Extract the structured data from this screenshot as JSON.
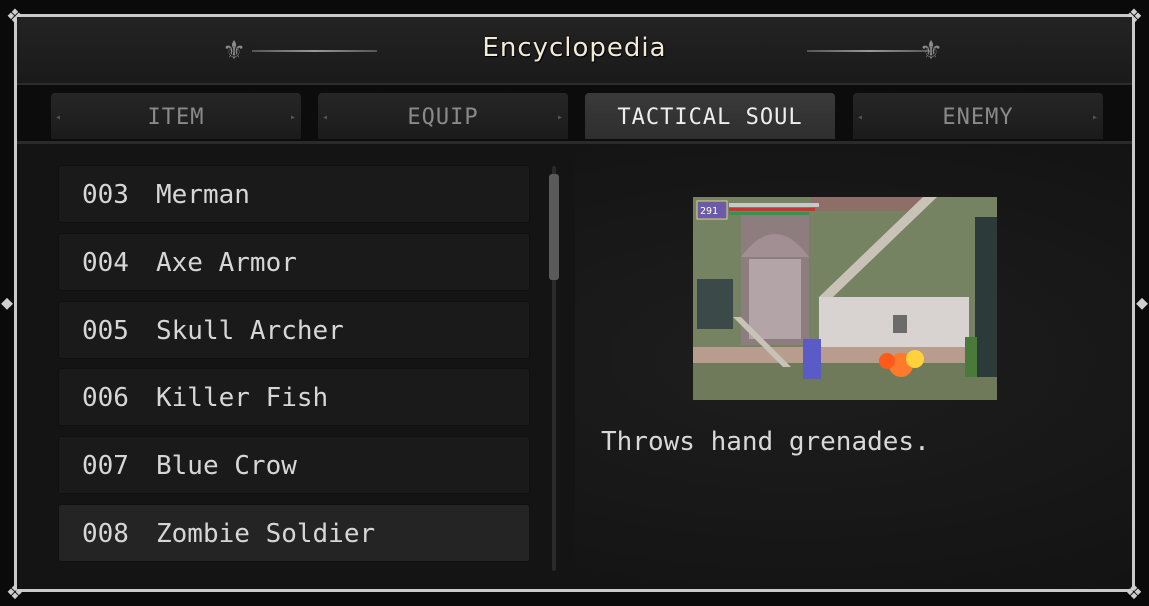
{
  "header": {
    "title": "Encyclopedia"
  },
  "tabs": [
    {
      "label": "ITEM",
      "active": false
    },
    {
      "label": "EQUIP",
      "active": false
    },
    {
      "label": "TACTICAL SOUL",
      "active": true
    },
    {
      "label": "ENEMY",
      "active": false
    }
  ],
  "list": {
    "items": [
      {
        "number": "003",
        "name": "Merman"
      },
      {
        "number": "004",
        "name": "Axe Armor"
      },
      {
        "number": "005",
        "name": "Skull Archer"
      },
      {
        "number": "006",
        "name": "Killer Fish"
      },
      {
        "number": "007",
        "name": "Blue Crow"
      },
      {
        "number": "008",
        "name": "Zombie Soldier"
      }
    ],
    "selected_index": 5
  },
  "detail": {
    "screenshot": {
      "hud_value": "291"
    },
    "description": "Throws hand grenades."
  },
  "colors": {
    "title_text": "#f0ead6",
    "active_tab": "#3a3a3a",
    "frame_border": "#c9c9c9"
  }
}
